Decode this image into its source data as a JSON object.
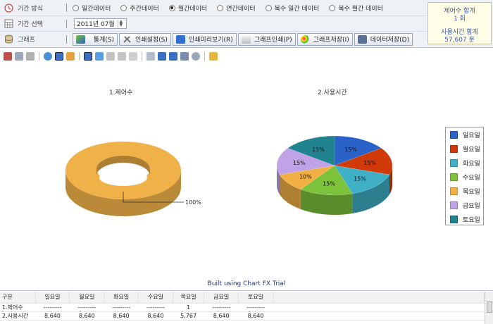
{
  "controls": {
    "period_method": {
      "label": "기간 방식",
      "options": [
        "일간데이터",
        "주간데이터",
        "월간데이터",
        "연간데이터",
        "복수 일간 데이터",
        "복수 월간 데이터"
      ],
      "selected": 2
    },
    "period_select": {
      "label": "기간 선택",
      "value": "2011년 07월"
    },
    "graph": {
      "label": "그래프",
      "buttons": [
        "통계(S)",
        "인쇄설정(S)",
        "인쇄미리보기(R)",
        "그래프인쇄(P)",
        "그래프저장(I)",
        "데이터저장(D)"
      ]
    }
  },
  "summary": {
    "label1": "제어수 합계",
    "value1": "1 회",
    "label2": "사용시간 합계",
    "value2": "57,607 분"
  },
  "colors": {
    "mon": "#2a63c8",
    "tue": "#cf3a08",
    "wed": "#3fb0c6",
    "thu": "#7cc23a",
    "fri": "#f1b044",
    "sat": "#c0a2e6",
    "sun": "#21838f",
    "donut": "#efb148"
  },
  "chart_data": [
    {
      "type": "pie",
      "title": "1.제어수",
      "categories": [
        "목요일"
      ],
      "values": [
        1
      ],
      "data_labels": [
        "100%"
      ]
    },
    {
      "type": "pie",
      "title": "2.사용시간",
      "categories": [
        "일요일",
        "월요일",
        "화요일",
        "수요일",
        "목요일",
        "금요일",
        "토요일"
      ],
      "values": [
        8640,
        8640,
        8640,
        8640,
        5767,
        8640,
        8640
      ],
      "data_labels": [
        "15%",
        "15%",
        "15%",
        "15%",
        "10%",
        "15%",
        "15%"
      ],
      "legend": "right"
    }
  ],
  "chart_footer": "Built using Chart FX Trial",
  "table": {
    "headers": [
      "구분",
      "일요일",
      "월요일",
      "화요일",
      "수요일",
      "목요일",
      "금요일",
      "토요일"
    ],
    "rows": [
      [
        "1.제어수",
        "---------",
        "---------",
        "---------",
        "---------",
        "1",
        "---------",
        "---------"
      ],
      [
        "2.사용시간",
        "8,640",
        "8,640",
        "8,640",
        "8,640",
        "5,767",
        "8,640",
        "8,640"
      ]
    ]
  }
}
